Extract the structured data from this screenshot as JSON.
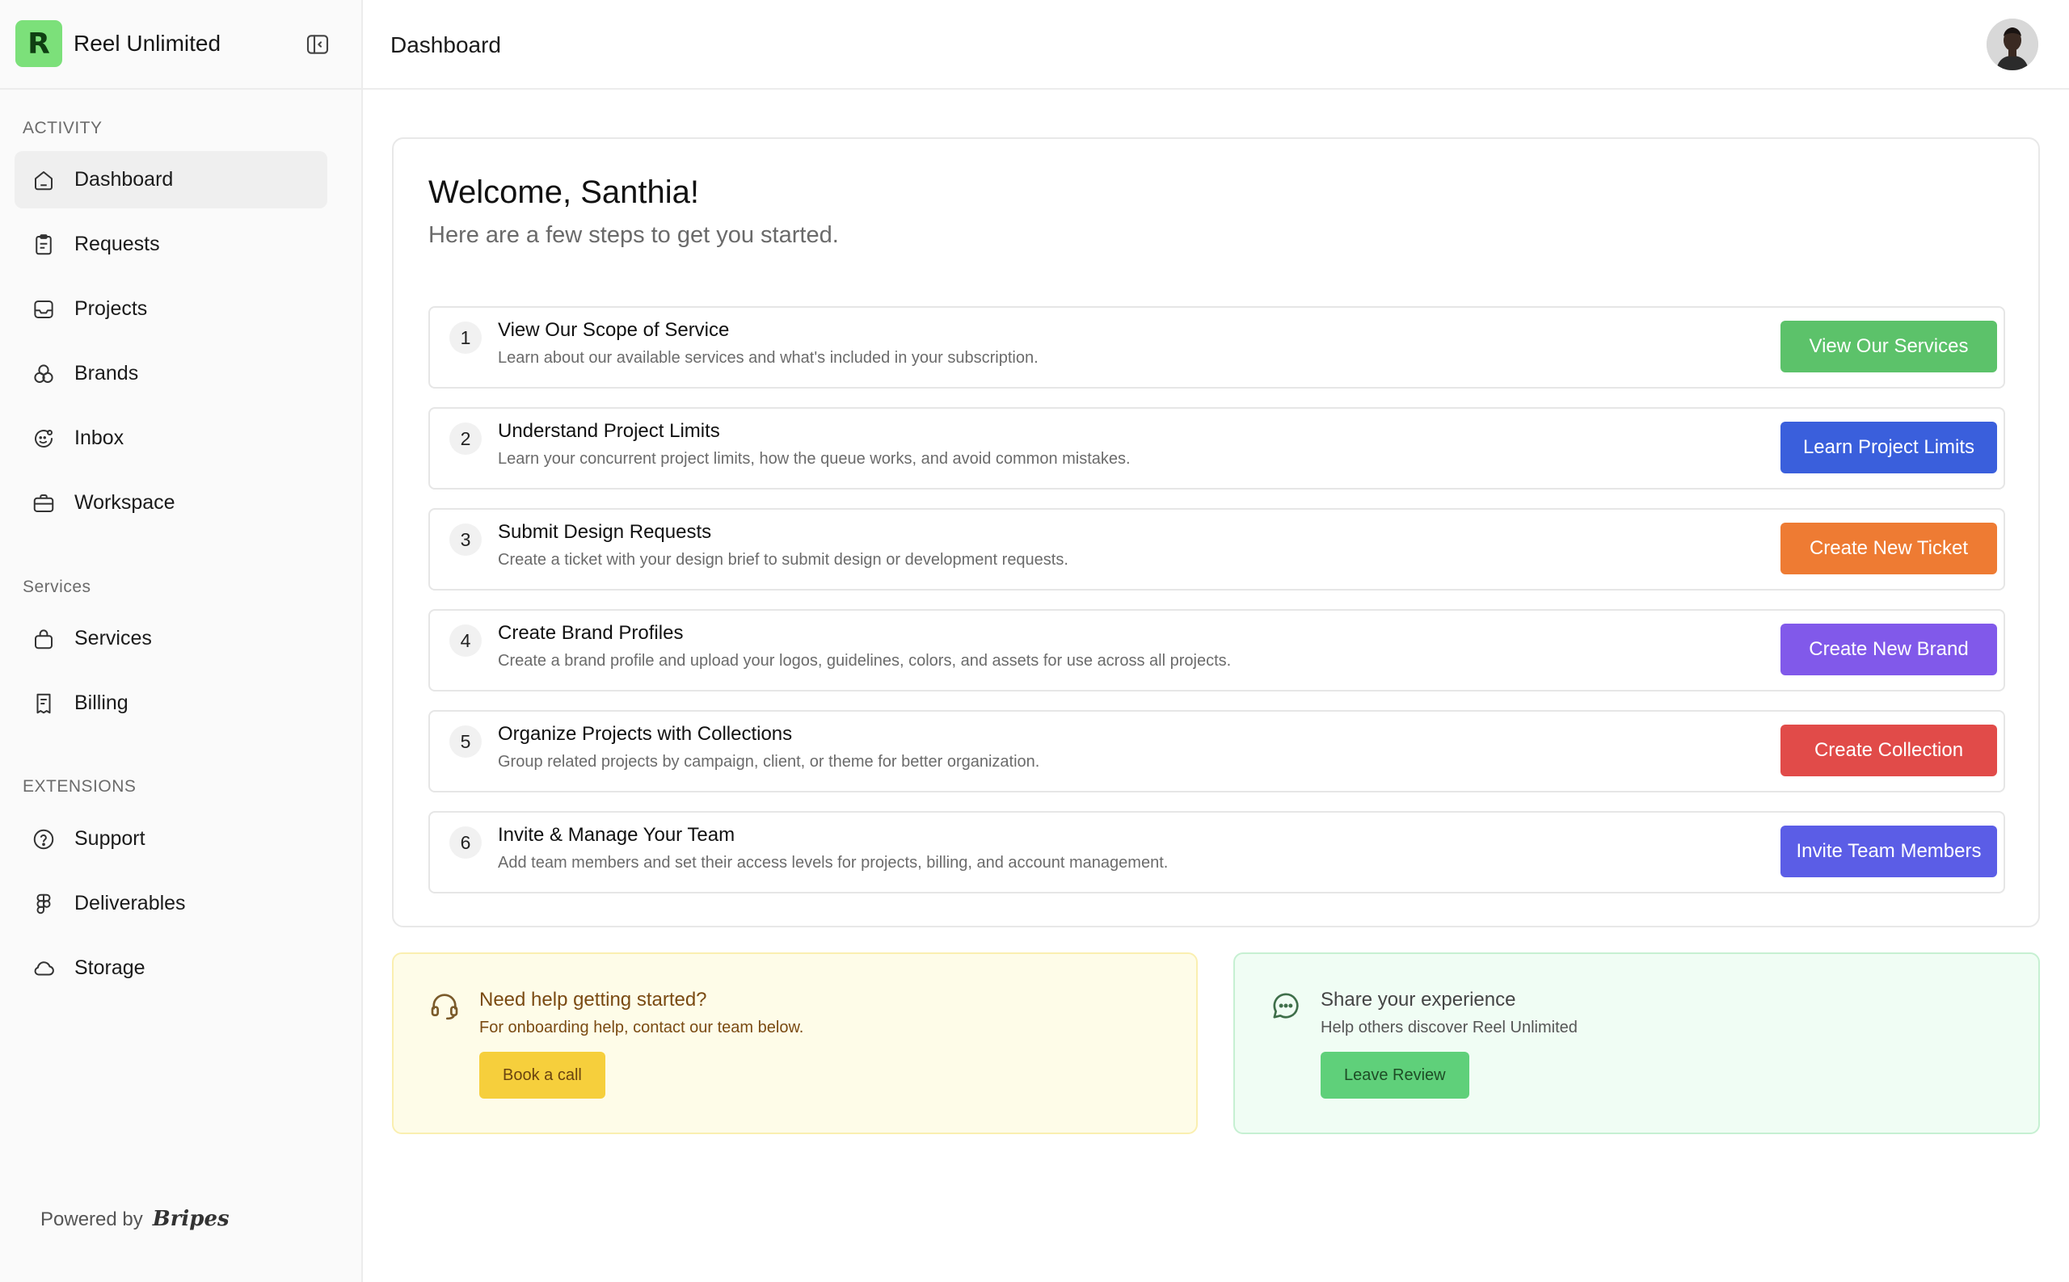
{
  "brand": {
    "logo_letter": "R",
    "name": "Reel Unlimited"
  },
  "header": {
    "title": "Dashboard"
  },
  "sidebar": {
    "sections": [
      {
        "label": "ACTIVITY",
        "items": [
          {
            "label": "Dashboard",
            "icon": "home-icon",
            "active": true
          },
          {
            "label": "Requests",
            "icon": "clipboard-icon"
          },
          {
            "label": "Projects",
            "icon": "inbox-tray-icon"
          },
          {
            "label": "Brands",
            "icon": "circles-icon"
          },
          {
            "label": "Inbox",
            "icon": "chat-icon"
          },
          {
            "label": "Workspace",
            "icon": "briefcase-icon"
          }
        ]
      },
      {
        "label": "Services",
        "items": [
          {
            "label": "Services",
            "icon": "bag-icon"
          },
          {
            "label": "Billing",
            "icon": "receipt-icon"
          }
        ]
      },
      {
        "label": "EXTENSIONS",
        "items": [
          {
            "label": "Support",
            "icon": "help-circle-icon"
          },
          {
            "label": "Deliverables",
            "icon": "figma-icon"
          },
          {
            "label": "Storage",
            "icon": "cloud-icon"
          }
        ]
      }
    ],
    "powered_by": "Powered by",
    "powered_brand": "Bripes"
  },
  "welcome": {
    "title": "Welcome, Santhia!",
    "subtitle": "Here are a few steps to get you started."
  },
  "steps": [
    {
      "number": "1",
      "title": "View Our Scope of Service",
      "description": "Learn about our available services and what's included in your subscription.",
      "button": "View Our Services",
      "color": "#5cc26a"
    },
    {
      "number": "2",
      "title": "Understand Project Limits",
      "description": "Learn your concurrent project limits, how the queue works, and avoid common mistakes.",
      "button": "Learn Project Limits",
      "color": "#3a5fdc"
    },
    {
      "number": "3",
      "title": "Submit Design Requests",
      "description": "Create a ticket with your design brief to submit design or development requests.",
      "button": "Create New Ticket",
      "color": "#ee7b33"
    },
    {
      "number": "4",
      "title": "Create Brand Profiles",
      "description": "Create a brand profile and upload your logos, guidelines, colors, and assets for use across all projects.",
      "button": "Create New Brand",
      "color": "#8159ea"
    },
    {
      "number": "5",
      "title": "Organize Projects with Collections",
      "description": "Group related projects by campaign, client, or theme for better organization.",
      "button": "Create Collection",
      "color": "#e14b49"
    },
    {
      "number": "6",
      "title": "Invite & Manage Your Team",
      "description": "Add team members and set their access levels for projects, billing, and account management.",
      "button": "Invite Team Members",
      "color": "#5b5de6"
    }
  ],
  "help_card": {
    "title": "Need help getting started?",
    "subtitle": "For onboarding help, contact our team below.",
    "button": "Book a call"
  },
  "review_card": {
    "title": "Share your experience",
    "subtitle": "Help others discover Reel Unlimited",
    "button": "Leave Review"
  }
}
